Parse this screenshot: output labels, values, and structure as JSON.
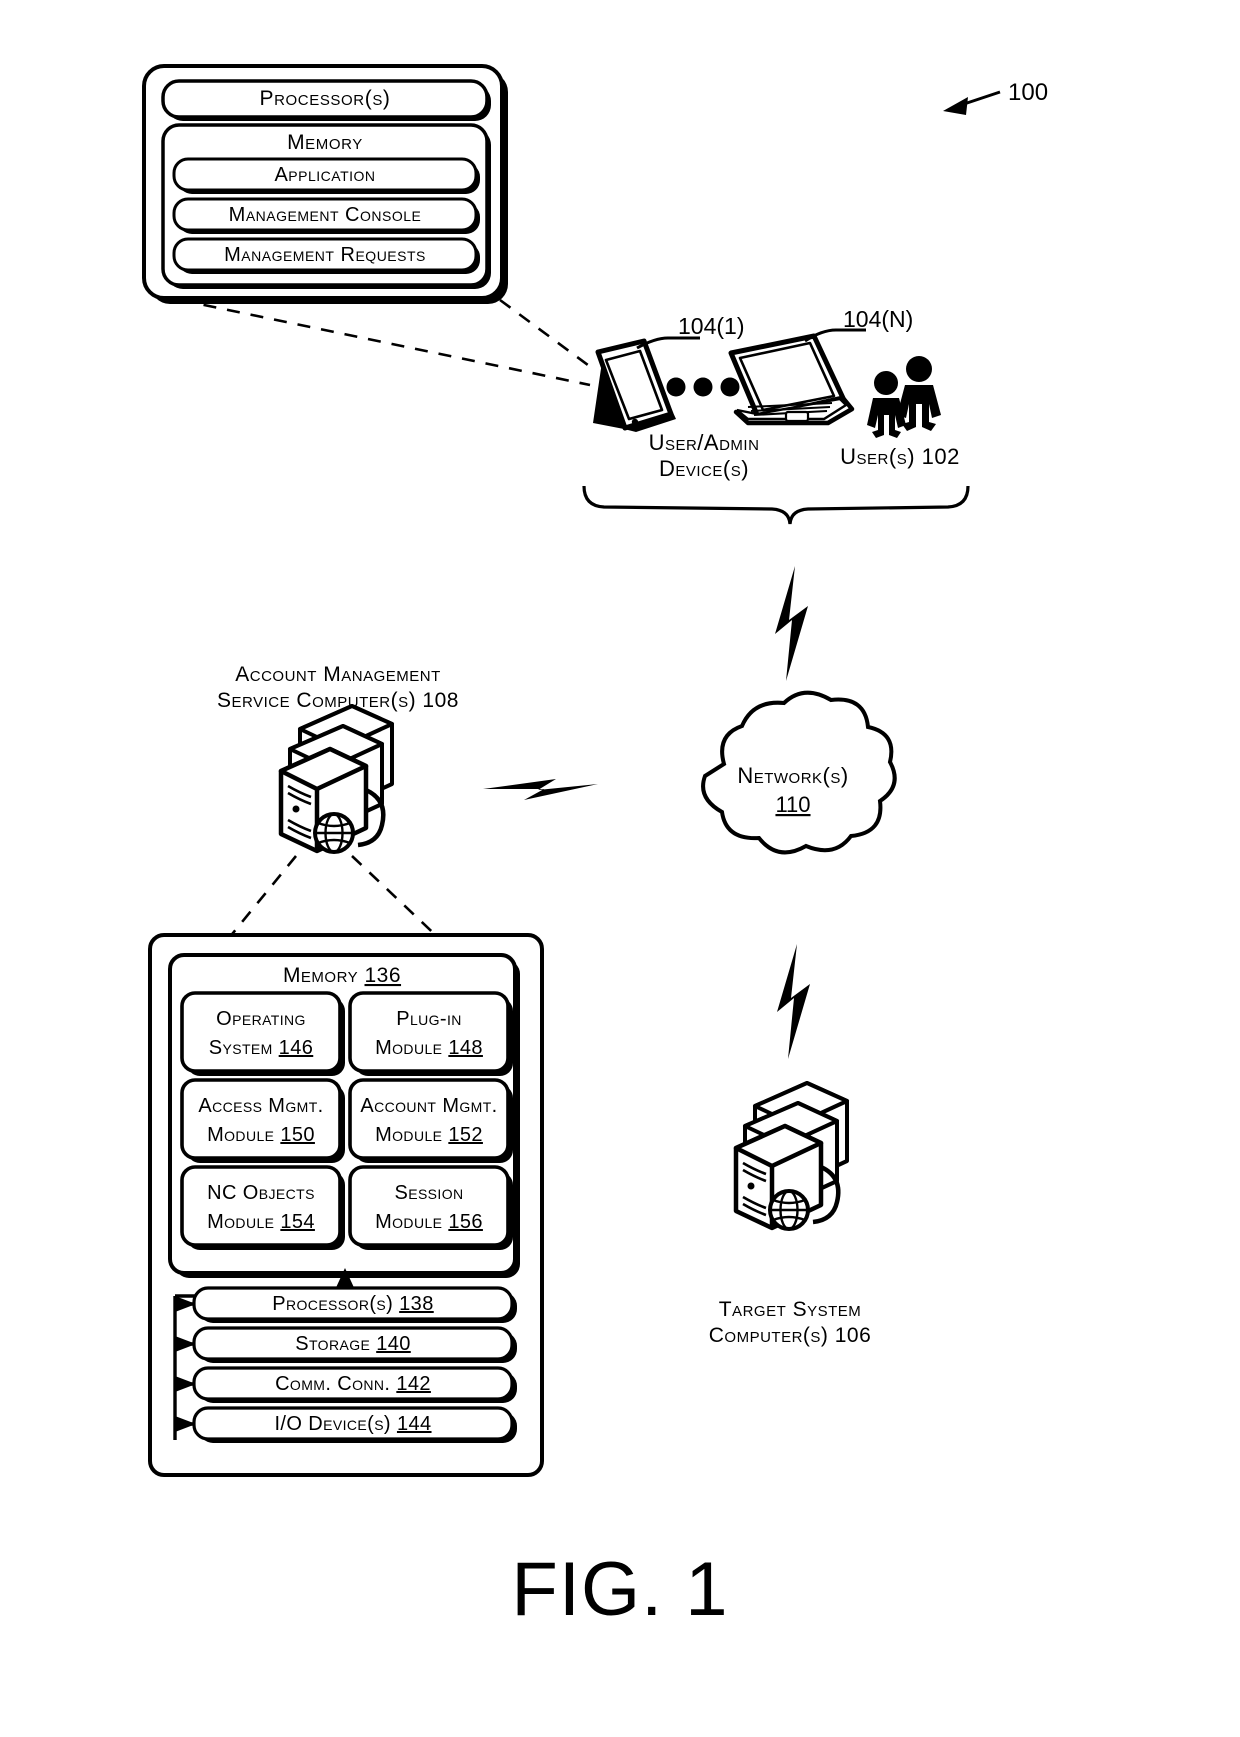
{
  "figure": {
    "caption": "FIG. 1",
    "system_ref": "100"
  },
  "user_device_block": {
    "processor_label": "Processor(s)",
    "memory_label": "Memory",
    "items": [
      "Application",
      "Management Console",
      "Management Requests"
    ]
  },
  "devices": {
    "tablet_ref": "104(1)",
    "laptop_ref": "104(N)",
    "ellipsis": "●●●",
    "device_label_line1": "User/Admin",
    "device_label_line2": "Device(s)",
    "users_label": "User(s) 102"
  },
  "network": {
    "label": "Network(s)",
    "ref": "110"
  },
  "service_computer": {
    "title_line1": "Account Management",
    "title_line2": "Service Computer(s) 108"
  },
  "target_system": {
    "label_line1": "Target System",
    "label_line2": "Computer(s) 106"
  },
  "memory_block": {
    "title_text": "Memory ",
    "title_ref": "136",
    "modules": [
      {
        "line1": "Operating",
        "line2": "System ",
        "ref": "146"
      },
      {
        "line1": "Plug-in",
        "line2": "Module ",
        "ref": "148"
      },
      {
        "line1": "Access Mgmt.",
        "line2": "Module ",
        "ref": "150"
      },
      {
        "line1": "Account Mgmt.",
        "line2": "Module ",
        "ref": "152"
      },
      {
        "line1": "NC Objects",
        "line2": "Module ",
        "ref": "154"
      },
      {
        "line1": "Session",
        "line2": "Module ",
        "ref": "156"
      }
    ],
    "bars": [
      {
        "text": "Processor(s) ",
        "ref": "138"
      },
      {
        "text": "Storage ",
        "ref": "140"
      },
      {
        "text": "Comm. Conn. ",
        "ref": "142"
      },
      {
        "text": "I/O Device(s) ",
        "ref": "144"
      }
    ]
  },
  "colors": {
    "line": "#000000",
    "fill": "#ffffff"
  }
}
